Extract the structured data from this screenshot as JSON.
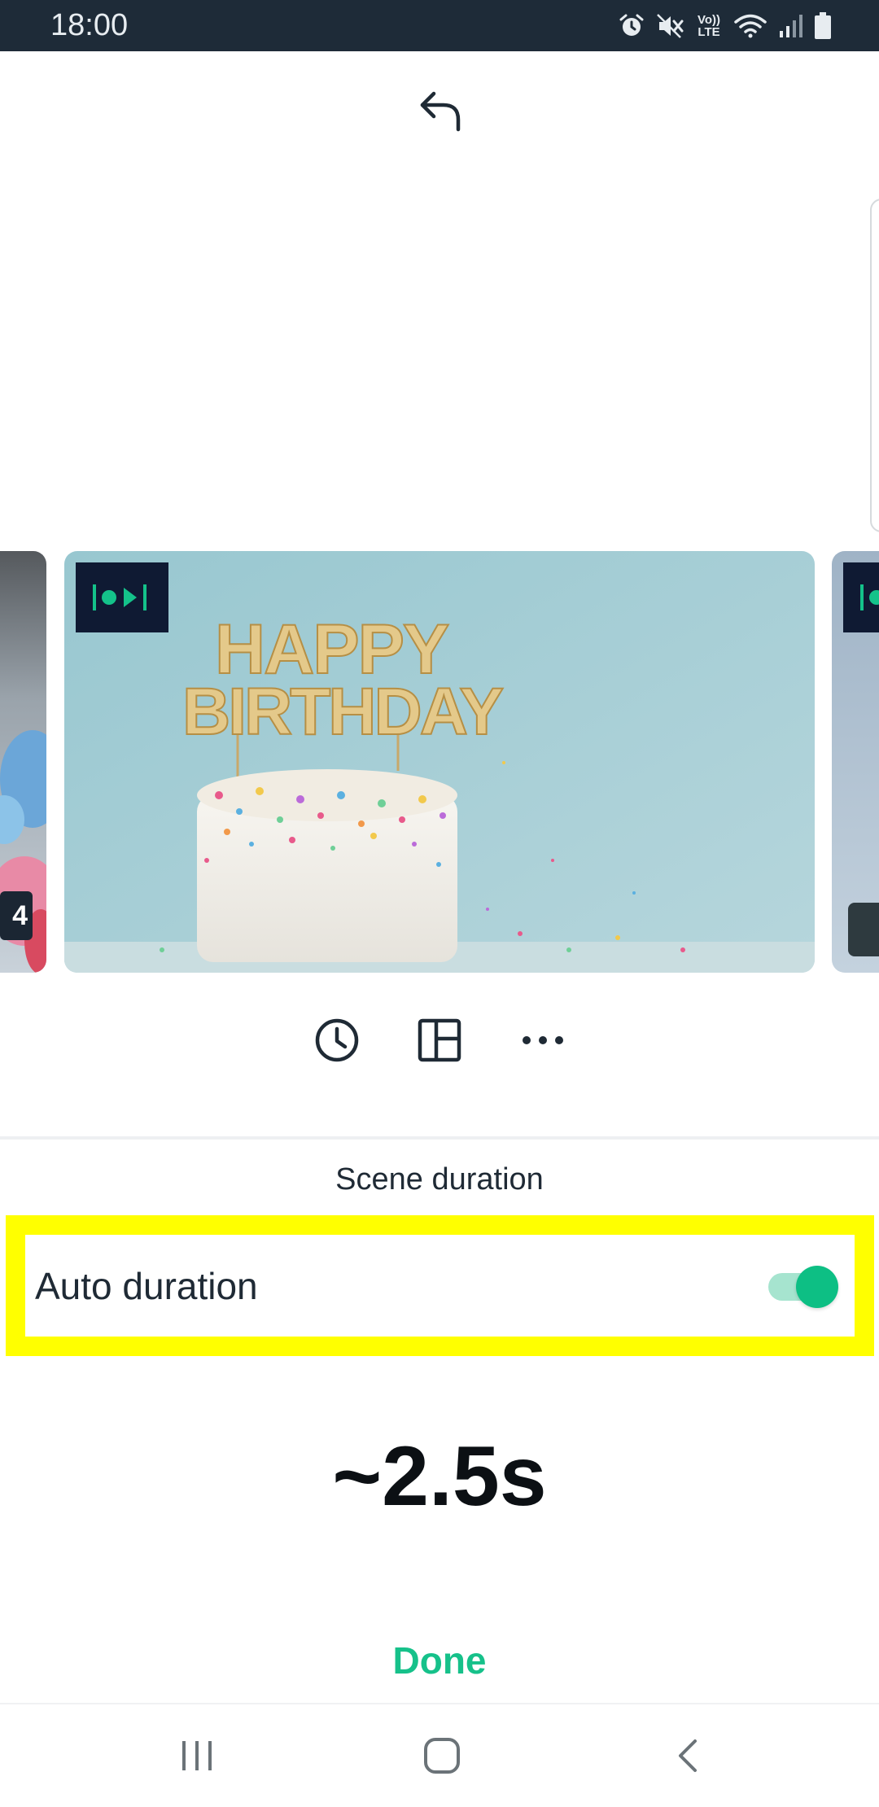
{
  "status_bar": {
    "time": "18:00",
    "volte_label": "Vo)) LTE",
    "icons": [
      "alarm-icon",
      "mute-icon",
      "volte-icon",
      "wifi-icon",
      "signal-icon",
      "battery-icon"
    ]
  },
  "header": {
    "undo_icon": "undo-arrow-icon"
  },
  "carousel": {
    "left_scene_number": "4",
    "main_scene_text": "HAPPY BIRTHDAY",
    "badge_icon": "scene-media-badge-icon"
  },
  "actions": {
    "items": [
      {
        "icon": "clock-icon"
      },
      {
        "icon": "layout-icon"
      },
      {
        "icon": "more-icon"
      }
    ]
  },
  "sheet": {
    "title": "Scene duration",
    "auto_duration_label": "Auto duration",
    "auto_duration_enabled": true,
    "duration_value": "~2.5s",
    "done_label": "Done"
  },
  "colors": {
    "accent": "#16c18a",
    "highlight": "#ffff00",
    "status_bar": "#1e2b38"
  },
  "nav": {
    "icons": [
      "recents-icon",
      "home-icon",
      "back-icon"
    ]
  }
}
